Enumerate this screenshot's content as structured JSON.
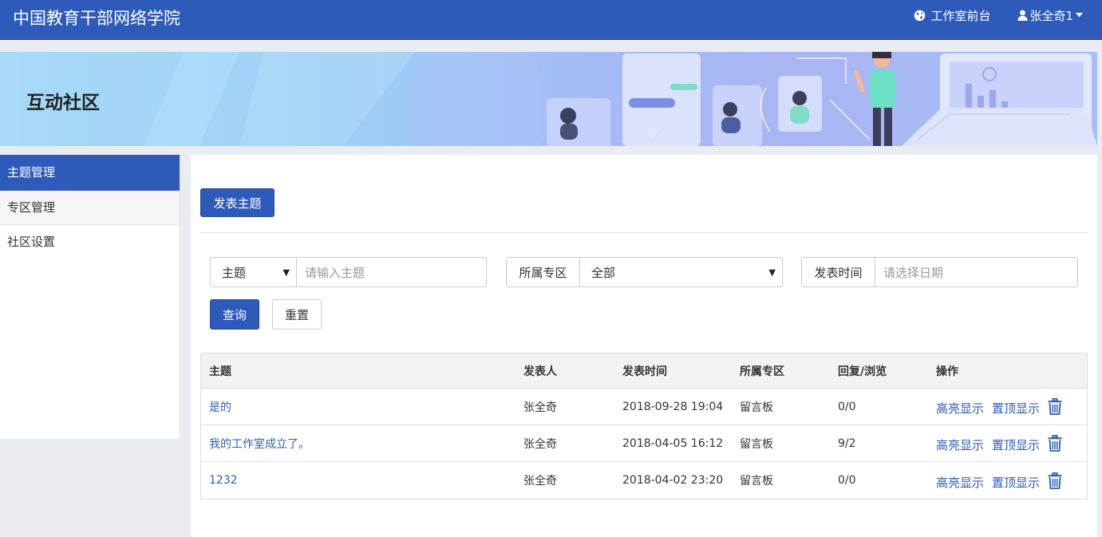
{
  "header": {
    "site_title": "中国教育干部网络学院",
    "studio_link": "工作室前台",
    "user_name": "张全奇1"
  },
  "banner": {
    "title": "互动社区"
  },
  "sidebar": {
    "items": [
      {
        "label": "主题管理"
      },
      {
        "label": "专区管理"
      },
      {
        "label": "社区设置"
      }
    ]
  },
  "toolbar": {
    "publish_label": "发表主题"
  },
  "filters": {
    "topic_type_selected": "主题",
    "topic_placeholder": "请输入主题",
    "zone_label": "所属专区",
    "zone_selected": "全部",
    "time_label": "发表时间",
    "time_placeholder": "请选择日期",
    "query_label": "查询",
    "reset_label": "重置"
  },
  "table": {
    "headers": [
      "主题",
      "发表人",
      "发表时间",
      "所属专区",
      "回复/浏览",
      "操作"
    ],
    "rows": [
      {
        "topic": "是的",
        "author": "张全奇",
        "time": "2018-09-28 19:04",
        "zone": "留言板",
        "stats": "0/0"
      },
      {
        "topic": "我的工作室成立了。",
        "author": "张全奇",
        "time": "2018-04-05 16:12",
        "zone": "留言板",
        "stats": "9/2"
      },
      {
        "topic": "1232",
        "author": "张全奇",
        "time": "2018-04-02 23:20",
        "zone": "留言板",
        "stats": "0/0"
      }
    ],
    "actions": {
      "highlight": "高亮显示",
      "pin": "置顶显示"
    }
  },
  "icons": {
    "globe": "globe-icon",
    "user": "user-icon",
    "caret": "caret-down-icon",
    "trash": "trash-icon"
  },
  "colors": {
    "primary": "#2e5bb9",
    "link": "#2e5bb9"
  }
}
